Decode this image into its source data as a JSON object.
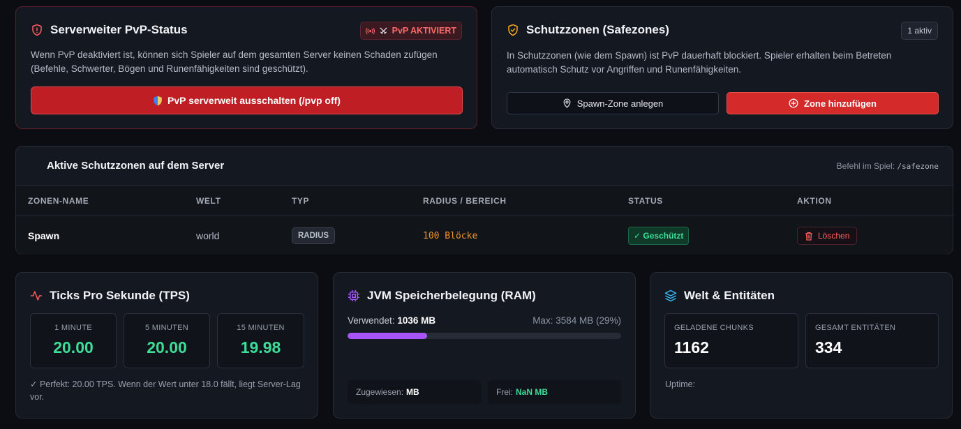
{
  "pvp": {
    "title": "Serverweiter PvP-Status",
    "badge": "PvP AKTIVIERT",
    "description": "Wenn PvP deaktiviert ist, können sich Spieler auf dem gesamten Server keinen Schaden zufügen (Befehle, Schwerter, Bögen und Runenfähigkeiten sind geschützt).",
    "toggle_button": "PvP serverweit ausschalten (/pvp off)",
    "title_icon": "shield-alert-icon",
    "badge_icon": "broadcast-icon",
    "colors": {
      "accent": "#bf1e24",
      "badge_text": "#ff6b6b"
    }
  },
  "safezones": {
    "title": "Schutzzonen (Safezones)",
    "count_badge": "1 aktiv",
    "description": "In Schutzzonen (wie dem Spawn) ist PvP dauerhaft blockiert. Spieler erhalten beim Betreten automatisch Schutz vor Angriffen und Runenfähigkeiten.",
    "spawn_button": "Spawn-Zone anlegen",
    "add_button": "Zone hinzufügen",
    "title_icon": "shield-check-icon"
  },
  "zones_table": {
    "title": "Aktive Schutzzonen auf dem Server",
    "command_label": "Befehl im Spiel:",
    "command": "/safezone",
    "columns": [
      "ZONEN-NAME",
      "WELT",
      "TYP",
      "RADIUS / BEREICH",
      "STATUS",
      "AKTION"
    ],
    "rows": [
      {
        "name": "Spawn",
        "world": "world",
        "type": "RADIUS",
        "radius": "100 Blöcke",
        "status": "✓ Geschützt",
        "action": "Löschen"
      }
    ]
  },
  "tps": {
    "title": "Ticks Pro Sekunde (TPS)",
    "title_icon": "activity-icon",
    "boxes": [
      {
        "label": "1 MINUTE",
        "value": "20.00"
      },
      {
        "label": "5 MINUTEN",
        "value": "20.00"
      },
      {
        "label": "15 MINUTEN",
        "value": "19.98"
      }
    ],
    "note": "✓ Perfekt: 20.00 TPS. Wenn der Wert unter 18.0 fällt, liegt Server-Lag vor."
  },
  "ram": {
    "title": "JVM Speicherbelegung (RAM)",
    "title_icon": "cpu-chip-icon",
    "used_label": "Verwendet:",
    "used_value": "1036 MB",
    "max_text": "Max: 3584 MB (29%)",
    "usage_fraction": 0.29,
    "allocated_label": "Zugewiesen:",
    "allocated_value": "MB",
    "free_label": "Frei:",
    "free_value": "NaN MB",
    "colors": {
      "bar": "#a855f7"
    }
  },
  "world": {
    "title": "Welt & Entitäten",
    "title_icon": "layers-icon",
    "chunks_label": "GELADENE CHUNKS",
    "chunks_value": "1162",
    "entities_label": "GESAMT ENTITÄTEN",
    "entities_value": "334",
    "uptime_label": "Uptime:"
  }
}
